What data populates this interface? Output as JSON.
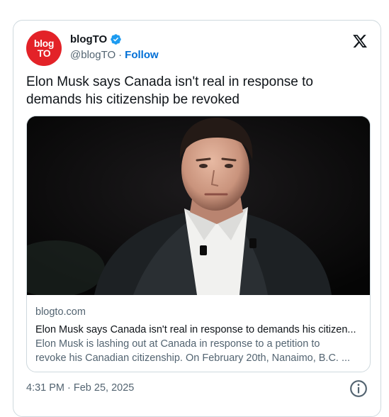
{
  "author": {
    "avatar_line1": "blog",
    "avatar_line2": "TO",
    "name": "blogTO",
    "handle": "@blogTO",
    "separator": "·",
    "follow_label": "Follow"
  },
  "icons": {
    "verified": "verified-badge-icon",
    "platform": "x-logo-icon",
    "info": "info-icon"
  },
  "colors": {
    "avatar_bg": "#e32228",
    "verified": "#1d9bf0",
    "follow": "#006fd6"
  },
  "tweet": {
    "text": "Elon Musk says Canada isn't real in response to demands his citizenship be revoked"
  },
  "link_card": {
    "domain": "blogto.com",
    "title": "Elon Musk says Canada isn't real in response to demands his citizen...",
    "description_line1": "Elon Musk is lashing out at Canada in response to a petition to",
    "description_line2": "revoke his Canadian citizenship. On February 20th, Nanaimo, B.C. ..."
  },
  "footer": {
    "timestamp": "4:31 PM · Feb 25, 2025"
  }
}
